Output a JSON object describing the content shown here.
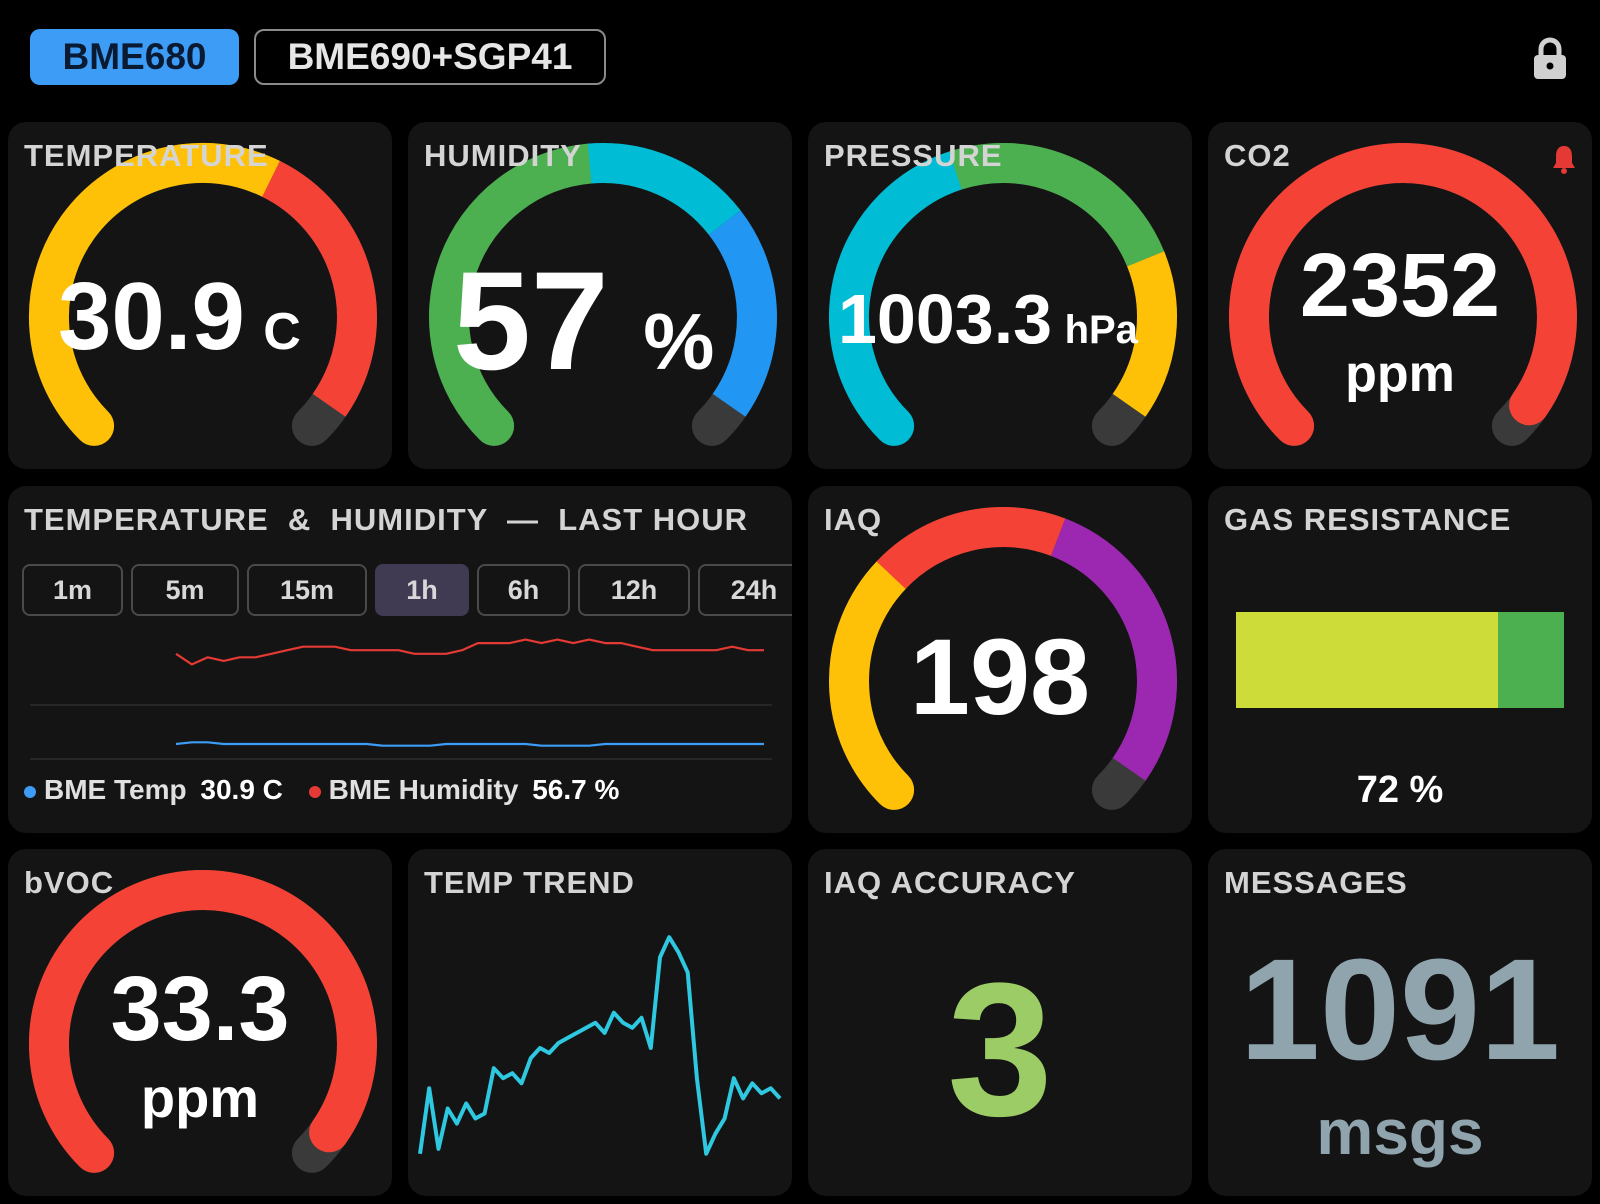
{
  "tabs": [
    {
      "label": "BME680",
      "active": true
    },
    {
      "label": "BME690+SGP41",
      "active": false
    }
  ],
  "colors": {
    "accent": "#3d9cf5",
    "background": "#000000",
    "card": "#141414"
  },
  "icons": {
    "lock": "lock-icon",
    "alarm": "bell-icon"
  },
  "temperature": {
    "title": "TEMPERATURE",
    "value": "30.9",
    "unit": "C"
  },
  "humidity": {
    "title": "HUMIDITY",
    "value": "57",
    "unit": "%"
  },
  "pressure": {
    "title": "PRESSURE",
    "value": "1003.3",
    "unit": "hPa"
  },
  "co2": {
    "title": "CO2",
    "value": "2352",
    "unit": "ppm",
    "alarm": true
  },
  "chart_panel": {
    "title": "TEMPERATURE  &  HUMIDITY  —  LAST HOUR",
    "ranges": [
      "1m",
      "5m",
      "15m",
      "1h",
      "6h",
      "12h",
      "24h"
    ],
    "selected_range": "1h",
    "legend": [
      {
        "label": "BME Temp",
        "value": "30.9 C",
        "color": "#3d9cf5"
      },
      {
        "label": "BME Humidity",
        "value": "56.7 %",
        "color": "#e53935"
      }
    ]
  },
  "iaq": {
    "title": "IAQ",
    "value": "198"
  },
  "gas_resistance": {
    "title": "GAS RESISTANCE",
    "value": "72 %",
    "level": 0.8
  },
  "bvoc": {
    "title": "bVOC",
    "value": "33.3",
    "unit": "ppm"
  },
  "temp_trend": {
    "title": "TEMP TREND"
  },
  "iaq_accuracy": {
    "title": "IAQ ACCURACY",
    "value": "3"
  },
  "messages": {
    "title": "MESSAGES",
    "value": "1091",
    "unit": "msgs"
  },
  "chart_data": [
    {
      "type": "line",
      "title": "",
      "series": [
        {
          "name": "BME Humidity",
          "color": "#e53935",
          "values": [
            56.9,
            56.6,
            56.8,
            56.7,
            56.8,
            56.8,
            56.9,
            57.0,
            57.1,
            57.1,
            57.1,
            57.0,
            57.0,
            57.0,
            57.0,
            56.9,
            56.9,
            56.9,
            57.0,
            57.2,
            57.2,
            57.2,
            57.3,
            57.2,
            57.3,
            57.2,
            57.3,
            57.2,
            57.2,
            57.1,
            57.0,
            57.0,
            57.0,
            57.0,
            57.0,
            57.1,
            57.0,
            57.0
          ]
        },
        {
          "name": "BME Temp",
          "color": "#3d9cf5",
          "values": [
            30.9,
            30.95,
            30.95,
            30.9,
            30.9,
            30.9,
            30.9,
            30.9,
            30.9,
            30.9,
            30.9,
            30.9,
            30.9,
            30.85,
            30.85,
            30.85,
            30.85,
            30.9,
            30.9,
            30.9,
            30.9,
            30.9,
            30.9,
            30.85,
            30.85,
            30.85,
            30.85,
            30.9,
            30.9,
            30.9,
            30.9,
            30.9,
            30.9,
            30.9,
            30.9,
            30.9,
            30.9,
            30.9
          ]
        }
      ]
    },
    {
      "type": "line",
      "title": "",
      "series": [
        {
          "name": "",
          "color": "#2ec8e0",
          "values": [
            5,
            18,
            6,
            14,
            11,
            15,
            12,
            13,
            22,
            20,
            21,
            19,
            24,
            26,
            25,
            27,
            28,
            29,
            30,
            31,
            29,
            33,
            31,
            30,
            32,
            26,
            44,
            48,
            45,
            41,
            20,
            5,
            9,
            12,
            20,
            16,
            19,
            17,
            18,
            16
          ]
        }
      ]
    }
  ]
}
